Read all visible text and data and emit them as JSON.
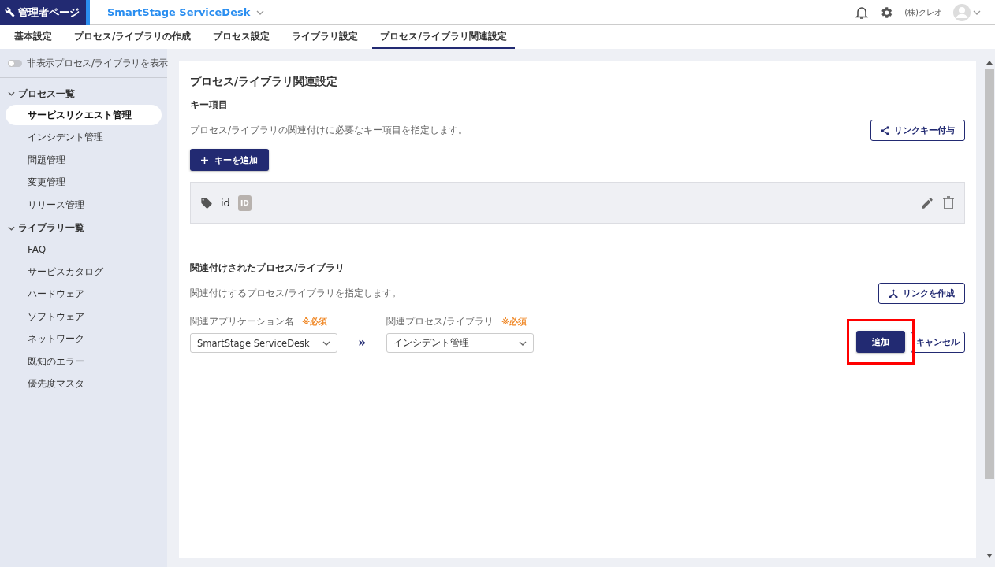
{
  "header": {
    "brand": "管理者ページ",
    "app": "SmartStage ServiceDesk",
    "user": "(株)クレオ"
  },
  "tabs": [
    {
      "label": "基本設定",
      "selected": false
    },
    {
      "label": "プロセス/ライブラリの作成",
      "selected": false
    },
    {
      "label": "プロセス設定",
      "selected": false
    },
    {
      "label": "ライブラリ設定",
      "selected": false
    },
    {
      "label": "プロセス/ライブラリ関連設定",
      "selected": true
    }
  ],
  "sidebar": {
    "toggle": {
      "label": "非表示プロセス/ライブラリを表示",
      "on": false
    },
    "groups": [
      {
        "label": "プロセス一覧",
        "expanded": true,
        "items": [
          {
            "label": "サービスリクエスト管理",
            "selected": true
          },
          {
            "label": "インシデント管理",
            "selected": false
          },
          {
            "label": "問題管理",
            "selected": false
          },
          {
            "label": "変更管理",
            "selected": false
          },
          {
            "label": "リリース管理",
            "selected": false
          }
        ]
      },
      {
        "label": "ライブラリ一覧",
        "expanded": true,
        "items": [
          {
            "label": "FAQ",
            "selected": false
          },
          {
            "label": "サービスカタログ",
            "selected": false
          },
          {
            "label": "ハードウェア",
            "selected": false
          },
          {
            "label": "ソフトウェア",
            "selected": false
          },
          {
            "label": "ネットワーク",
            "selected": false
          },
          {
            "label": "既知のエラー",
            "selected": false
          },
          {
            "label": "優先度マスタ",
            "selected": false
          }
        ]
      }
    ]
  },
  "main": {
    "title": "プロセス/ライブラリ関連設定",
    "key_section": {
      "heading": "キー項目",
      "description": "プロセス/ライブラリの関連付けに必要なキー項目を指定します。",
      "link_button": "リンクキー付与",
      "add_button": "キーを追加",
      "keys": [
        {
          "name": "id",
          "badge": "ID"
        }
      ]
    },
    "related_section": {
      "heading": "関連付けされたプロセス/ライブラリ",
      "description": "関連付けするプロセス/ライブラリを指定します。",
      "link_button": "リンクを作成",
      "fields": [
        {
          "label": "関連アプリケーション名",
          "required": "※必須",
          "value": "SmartStage ServiceDesk"
        },
        {
          "label": "関連プロセス/ライブラリ",
          "required": "※必須",
          "value": "インシデント管理"
        }
      ],
      "separator": "»",
      "add_button": {
        "label": "追加",
        "highlighted": true
      },
      "cancel_button": "キャンセル"
    }
  }
}
